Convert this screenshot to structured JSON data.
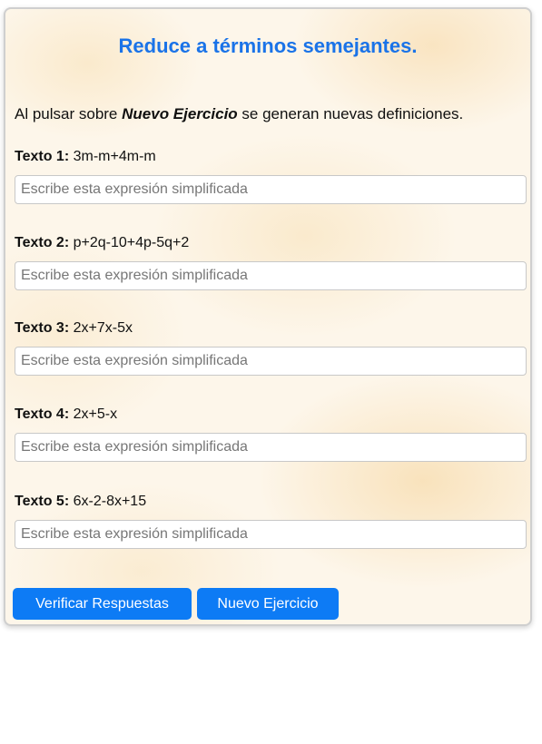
{
  "title": "Reduce a términos semejantes.",
  "intro": {
    "before": "Al pulsar sobre ",
    "emphasis": "Nuevo Ejercicio",
    "after": " se generan nuevas definiciones."
  },
  "exercises": [
    {
      "label": "Texto 1:",
      "expression": "3m-m+4m-m",
      "placeholder": "Escribe esta expresión simplificada",
      "value": ""
    },
    {
      "label": "Texto 2:",
      "expression": "p+2q-10+4p-5q+2",
      "placeholder": "Escribe esta expresión simplificada",
      "value": ""
    },
    {
      "label": "Texto 3:",
      "expression": "2x+7x-5x",
      "placeholder": "Escribe esta expresión simplificada",
      "value": ""
    },
    {
      "label": "Texto 4:",
      "expression": "2x+5-x",
      "placeholder": "Escribe esta expresión simplificada",
      "value": ""
    },
    {
      "label": "Texto 5:",
      "expression": "6x-2-8x+15",
      "placeholder": "Escribe esta expresión simplificada",
      "value": ""
    }
  ],
  "buttons": {
    "verify": "Verificar Respuestas",
    "new_exercise": "Nuevo Ejercicio"
  },
  "colors": {
    "accent": "#1a73e8",
    "button": "#0d7bf5"
  }
}
